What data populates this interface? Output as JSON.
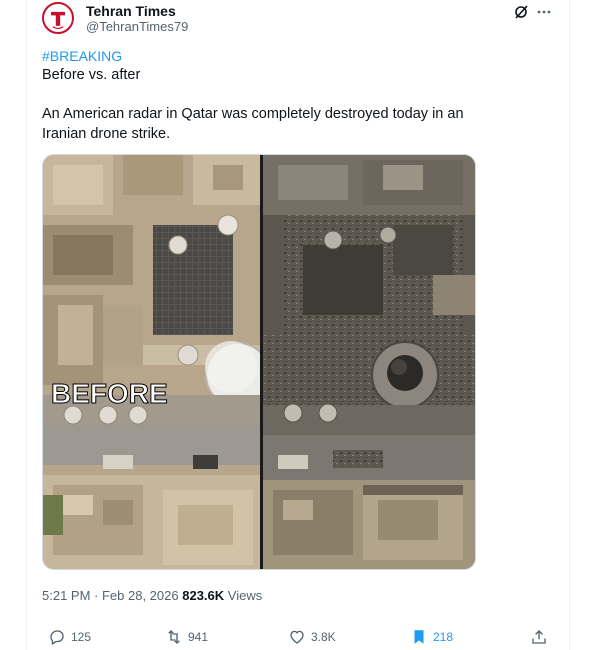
{
  "author": {
    "name": "Tehran Times",
    "handle": "@TehranTimes79",
    "avatar_letter": "T"
  },
  "post": {
    "hashtag": "#BREAKING",
    "line1": "Before vs. after",
    "text_line1": "An American radar in Qatar was completely destroyed today in an",
    "text_line2": "Iranian drone strike.",
    "media_label": "BEFORE"
  },
  "meta": {
    "time": "5:21 PM",
    "separator": " · ",
    "date": "Feb 28, 2026",
    "views_count": "823.6K",
    "views_label": "Views"
  },
  "actions": {
    "replies": "125",
    "reposts": "941",
    "likes": "3.8K",
    "bookmarks": "218"
  },
  "colors": {
    "link": "#1d9bf0",
    "muted": "#536471",
    "text": "#0f1419",
    "brand": "#c8102e"
  },
  "icons": [
    "grok-icon",
    "more-icon",
    "reply-icon",
    "repost-icon",
    "like-icon",
    "bookmark-icon",
    "share-icon"
  ]
}
